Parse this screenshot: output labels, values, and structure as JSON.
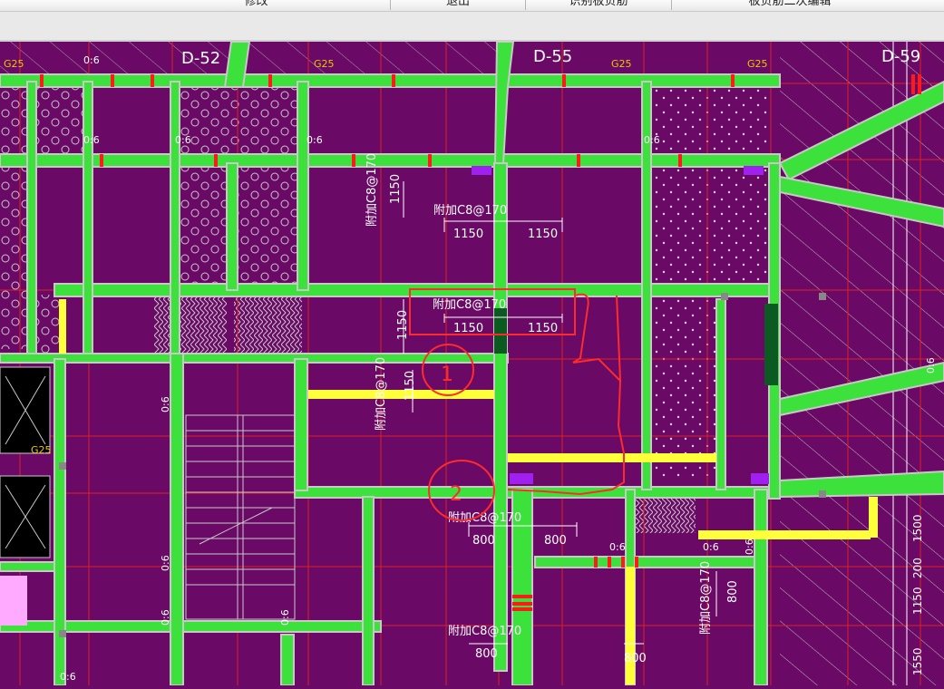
{
  "toolbar": {
    "buttons": [
      "修改",
      "退出",
      "识别板负筋",
      "板负筋二次编辑"
    ]
  },
  "drawing": {
    "axes": [
      "D-52",
      "D-55",
      "D-59"
    ],
    "beam_tag": "G25",
    "slab_mark": "0:6",
    "rebar": {
      "r1": "附加C8@170",
      "r1_dims": [
        "1150",
        "1150"
      ],
      "r2": "附加C8@170",
      "r2_dims": [
        "1150",
        "1150"
      ],
      "r3": "附加C8@170",
      "r3_dim": "1150",
      "r4": "附加C8@170",
      "r4_dims": [
        "1150",
        "1150"
      ],
      "r5": "附加C8@170",
      "r5_dims": [
        "800",
        "800"
      ],
      "r6": "附加C8@170",
      "r6_dim": "800",
      "r7": "附加C8@170",
      "r7_dims": [
        "800",
        "800"
      ]
    },
    "side_dims": [
      "1500",
      "200",
      "1150",
      "1550"
    ],
    "annotations": [
      "1",
      "2"
    ],
    "colors": {
      "background": "#6a0a66",
      "beam_fill": "#3ce13c",
      "beam_edge": "#c8c8c8",
      "axis_lines": "#e02020",
      "rebar_marks": "#ff1a1a",
      "annotation_red": "#ff2a2a",
      "yellow": "#ffff3a",
      "dims_white": "#ffffff"
    }
  }
}
